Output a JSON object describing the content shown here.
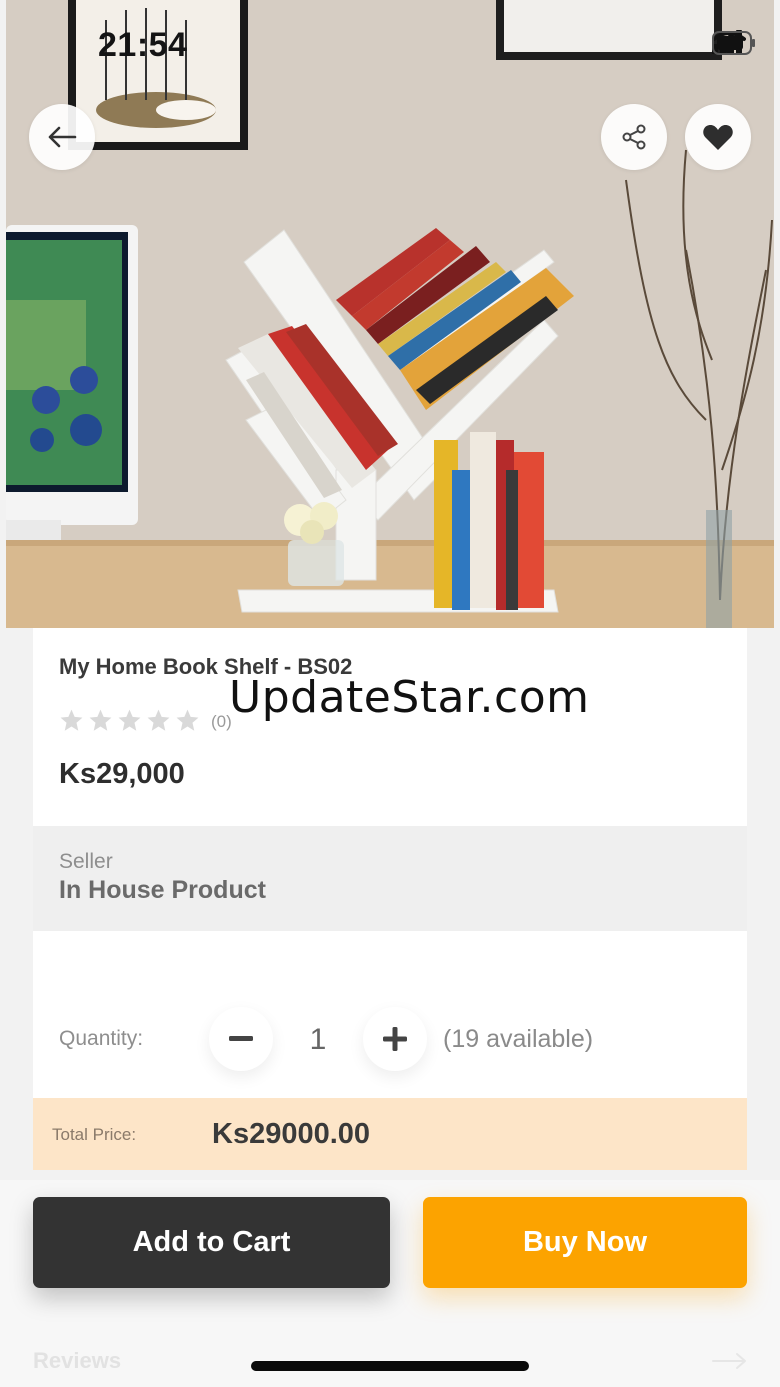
{
  "status_bar": {
    "time": "21:54"
  },
  "header": {
    "back_icon": "arrow-left-icon",
    "share_icon": "share-icon",
    "favorite_icon": "heart-icon"
  },
  "product": {
    "title": "My Home Book Shelf - BS02",
    "rating": {
      "stars_filled": 0,
      "stars_total": 5,
      "count_label": "(0)"
    },
    "price": "Ks29,000"
  },
  "watermark": "UpdateStar.com",
  "seller": {
    "label": "Seller",
    "name": "In House Product"
  },
  "quantity": {
    "label": "Quantity:",
    "value": "1",
    "available": "(19 available)",
    "minus_icon": "minus-icon",
    "plus_icon": "plus-icon"
  },
  "total": {
    "label": "Total Price:",
    "value": "Ks29000.00"
  },
  "actions": {
    "add_to_cart": "Add to Cart",
    "buy_now": "Buy Now"
  },
  "reviews": {
    "label": "Reviews"
  },
  "colors": {
    "buy_now": "#fca300",
    "add_to_cart": "#333333",
    "total_bg": "#fde5c8",
    "seller_bg": "#efefef"
  }
}
